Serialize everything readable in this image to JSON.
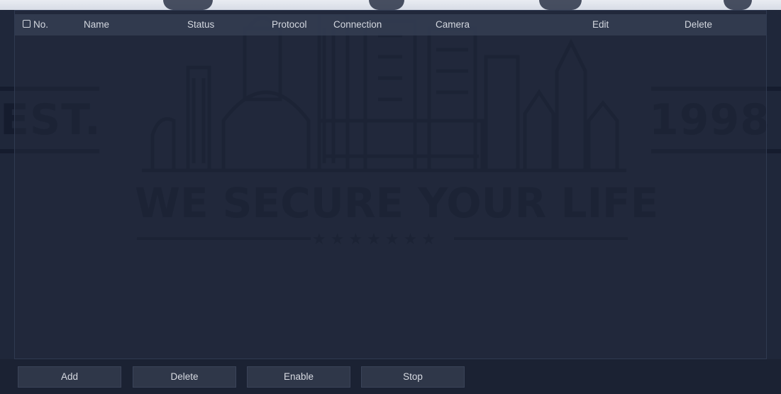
{
  "table": {
    "columns": {
      "no": "No.",
      "name": "Name",
      "status": "Status",
      "protocol": "Protocol",
      "connection": "Connection",
      "camera": "Camera",
      "edit": "Edit",
      "delete": "Delete"
    },
    "select_all_checked": false,
    "rows": []
  },
  "wallpaper": {
    "left_text": "EST.",
    "right_text": "1998",
    "slogan": "WE SECURE YOUR LIFE",
    "stars": "★★★★★★★"
  },
  "buttons": {
    "add": "Add",
    "delete": "Delete",
    "enable": "Enable",
    "stop": "Stop"
  },
  "colors": {
    "background": "#1f273a",
    "header": "#343d52",
    "text": "#d3d7df",
    "button": "#2f3749"
  }
}
